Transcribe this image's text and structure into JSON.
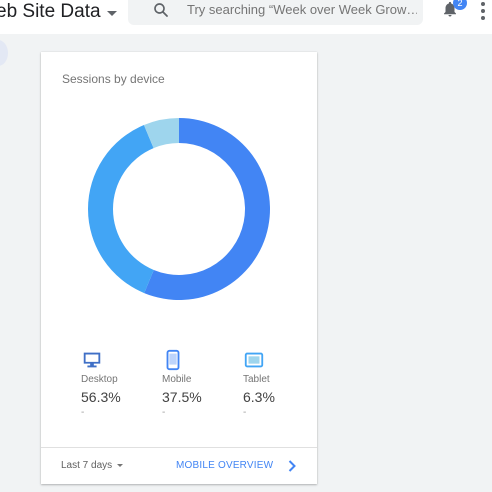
{
  "header": {
    "property_title": "eb Site Data",
    "search_placeholder": "Try searching “Week over Week Grow…",
    "notification_count": "2"
  },
  "card": {
    "title": "Sessions by device",
    "metrics": [
      {
        "icon": "desktop-icon",
        "label": "Desktop",
        "value": "56.3%",
        "delta": "-"
      },
      {
        "icon": "mobile-icon",
        "label": "Mobile",
        "value": "37.5%",
        "delta": "-"
      },
      {
        "icon": "tablet-icon",
        "label": "Tablet",
        "value": "6.3%",
        "delta": "-"
      }
    ],
    "date_range": "Last 7 days",
    "link_label": "MOBILE OVERVIEW"
  },
  "colors": {
    "desktop": "#4285f4",
    "mobile": "#42a5f5",
    "tablet": "#9ed5ed",
    "accent": "#4285f4"
  },
  "chart_data": {
    "type": "pie",
    "title": "Sessions by device",
    "categories": [
      "Desktop",
      "Mobile",
      "Tablet"
    ],
    "values": [
      56.3,
      37.5,
      6.3
    ],
    "style": "donut"
  }
}
